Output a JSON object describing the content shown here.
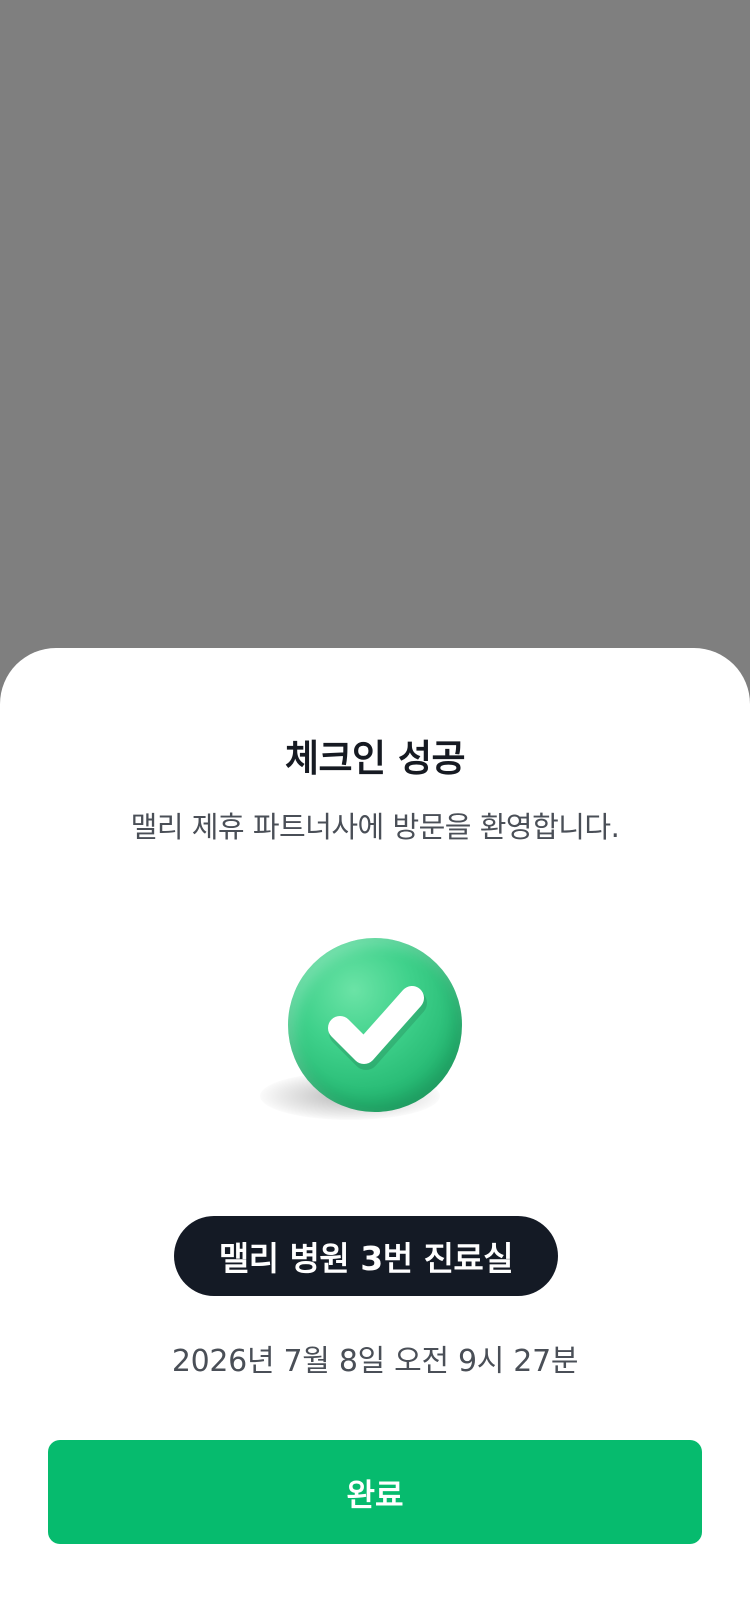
{
  "modal": {
    "title": "체크인 성공",
    "subtitle": "맬리 제휴 파트너사에 방문을 환영합니다.",
    "success_icon": "check-circle-icon",
    "location": "맬리 병원 3번 진료실",
    "datetime": "2026년 7월 8일 오전 9시 27분",
    "done_label": "완료"
  },
  "colors": {
    "backdrop": "#7f7f7f",
    "sheet": "#ffffff",
    "pill": "#141a25",
    "primary": "#06bb6e",
    "check_green": "#3fd18b"
  }
}
